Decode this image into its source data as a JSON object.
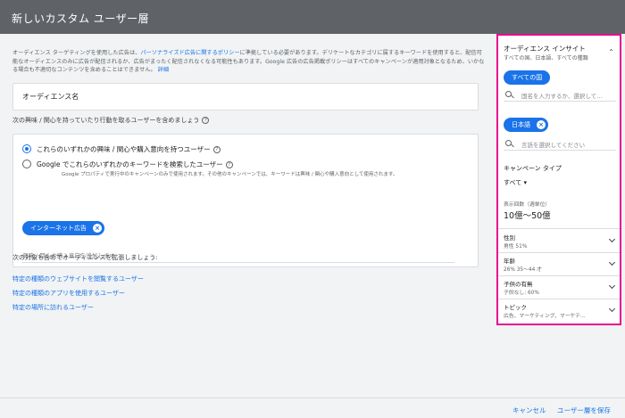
{
  "header": {
    "title": "新しいカスタム ユーザー層"
  },
  "policy": {
    "text_before": "オーディエンス ターゲティングを使用した広告は、",
    "link": "パーソナライズド広告に関するポリシー",
    "text_after": "に準拠している必要があります。デリケートなカテゴリに属するキーワードを使用すると、配信可能なオーディエンスのみに広告が配信されるか、広告がまったく配信されなくなる可能性もあります。Google 広告の広告掲載ポリシーはすべてのキャンペーンが適用対象となるため、いかなる場合も不適切なコンテンツを含めることはできません。",
    "details": "詳細"
  },
  "name_field": {
    "label": "オーディエンス名"
  },
  "include_question": "次の興味 / 関心を持っていたり行動を取るユーザーを含めましょう",
  "options": {
    "opt1": "これらのいずれかの興味 / 関心や購入意向を持つユーザー",
    "opt2": "Google でこれらのいずれかのキーワードを検索したユーザー",
    "opt2_sub": "Google プロパティで実行中のキャンペーンのみで使用されます。その他のキャンペーンでは、キーワードは興味 / 関心や購入意向として使用されます。"
  },
  "chip": {
    "label": "インターネット広告"
  },
  "add_input": {
    "placeholder": "興味 / 関心や購入意向を追加します"
  },
  "expand_question": "次の対象も含めてオーディエンスを拡張しましょう:",
  "links": [
    "特定の種類のウェブサイトを閲覧するユーザー",
    "特定の種類のアプリを使用するユーザー",
    "特定の場所に訪れるユーザー"
  ],
  "panel": {
    "title": "オーディエンス インサイト",
    "subtitle": "すべての国、日本語、すべての種類",
    "country_chip": "すべての国",
    "country_placeholder": "国名を入力するか、選択して…",
    "lang_chip": "日本語",
    "lang_placeholder": "言語を選択してください",
    "campaign_type_label": "キャンペーン タイプ",
    "campaign_type_value": "すべて",
    "impressions_label": "表示回数（週単位）",
    "impressions_value": "10億～50億",
    "rows": [
      {
        "label": "性別",
        "value": "男性 51%"
      },
      {
        "label": "年齢",
        "value": "26% 35～44 才"
      },
      {
        "label": "子供の有無",
        "value": "子供なし: 60%"
      },
      {
        "label": "トピック",
        "value": "広告、マーケティング、マーケテ…"
      }
    ]
  },
  "footer": {
    "cancel": "キャンセル",
    "save": "ユーザー層を保存"
  },
  "colors": {
    "accent": "#1a73e8",
    "highlight": "#e8088e",
    "header": "#5f6368"
  }
}
